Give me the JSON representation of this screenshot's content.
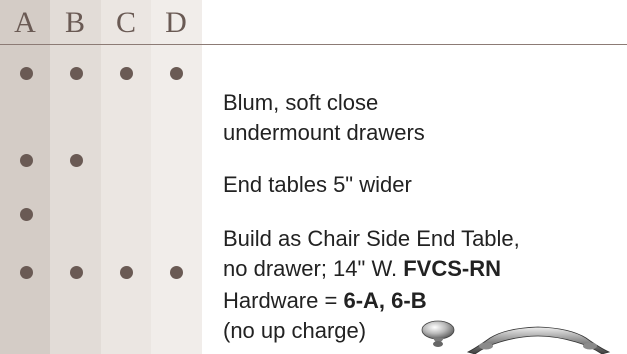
{
  "columns": [
    "A",
    "B",
    "C",
    "D"
  ],
  "rows": [
    {
      "marks": [
        true,
        true,
        true,
        true
      ],
      "lines": [
        {
          "text": "Blum, soft close"
        },
        {
          "text": "undermount drawers"
        }
      ]
    },
    {
      "marks": [
        true,
        true,
        false,
        false
      ],
      "lines": [
        {
          "text": "End tables 5\" wider"
        }
      ]
    },
    {
      "marks": [
        true,
        false,
        false,
        false
      ],
      "lines": [
        {
          "text": "Build as Chair Side End Table,"
        },
        {
          "text": "no drawer; 14\" W. ",
          "bold": "FVCS-RN"
        }
      ]
    },
    {
      "marks": [
        true,
        true,
        true,
        true
      ],
      "lines": [
        {
          "text": "Hardware = ",
          "bold": "6-A, 6-B"
        },
        {
          "text": "(no up charge)"
        }
      ]
    }
  ],
  "colors": {
    "dot": "#6a5a54",
    "rule": "#8c7b75",
    "text": "#222222"
  },
  "icons": [
    "knob-hardware-icon",
    "pull-handle-hardware-icon"
  ]
}
